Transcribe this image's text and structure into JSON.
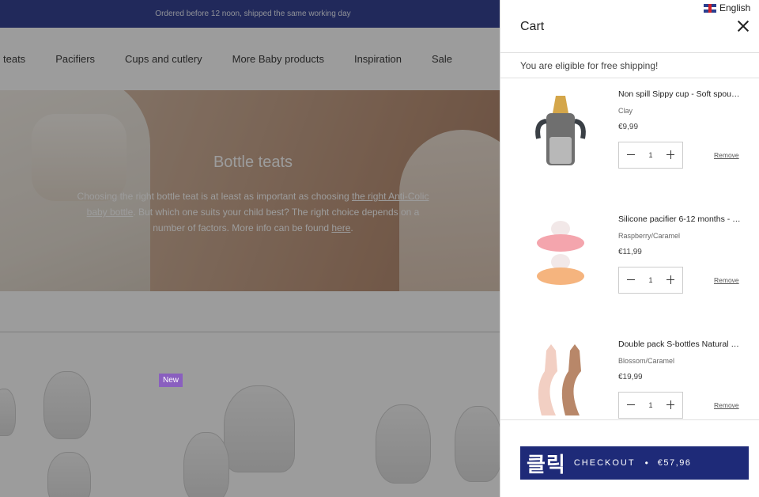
{
  "topbar": {
    "text": "Ordered before 12 noon, shipped the same working day"
  },
  "nav": {
    "items": [
      "teats",
      "Pacifiers",
      "Cups and cutlery",
      "More Baby products",
      "Inspiration",
      "Sale"
    ]
  },
  "hero": {
    "title": "Bottle teats",
    "text_1": "Choosing the right bottle teat is at least as important as choosing ",
    "link_1": "the right Anti-Colic baby bottle",
    "text_2": ". But which one suits your child best? The right choice depends on a number of factors. More info can be found ",
    "link_2": "here",
    "text_3": "."
  },
  "products": {
    "badge": "New"
  },
  "language": {
    "label": "English",
    "icon": "uk-flag-icon"
  },
  "cart": {
    "title": "Cart",
    "shipping_message": "You are eligible for free shipping!",
    "items": [
      {
        "name": "Non spill Sippy cup - Soft spout -...",
        "variant": "Clay",
        "price": "€9,99",
        "qty": "1",
        "remove": "Remove",
        "image": "sippy-cup-icon"
      },
      {
        "name": "Silicone pacifier 6-12 months - 2...",
        "variant": "Raspberry/Caramel",
        "price": "€11,99",
        "qty": "1",
        "remove": "Remove",
        "image": "pacifier-icon"
      },
      {
        "name": "Double pack S-bottles Natural 2...",
        "variant": "Blossom/Caramel",
        "price": "€19,99",
        "qty": "1",
        "remove": "Remove",
        "image": "bottles-icon"
      }
    ],
    "checkout": {
      "korean": "클릭",
      "label": "CHECKOUT",
      "separator": "•",
      "total": "€57,96"
    }
  },
  "colors": {
    "topbar": "#2b3a8f",
    "checkout": "#1e2a78",
    "badge": "#8a5fbf"
  }
}
